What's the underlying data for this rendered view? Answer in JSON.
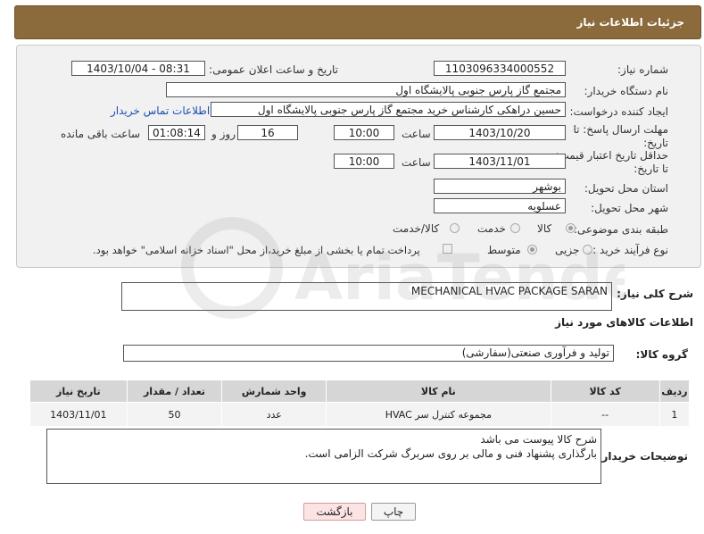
{
  "header": {
    "title": "جزئیات اطلاعات نیاز"
  },
  "form": {
    "need_number_label": "شماره نیاز:",
    "need_number": "1103096334000552",
    "announce_label": "تاریخ و ساعت اعلان عمومی:",
    "announce_value": "1403/10/04 - 08:31",
    "buyer_org_label": "نام دستگاه خریدار:",
    "buyer_org": "مجتمع گاز پارس جنوبی  پالایشگاه اول",
    "creator_label": "ایجاد کننده درخواست:",
    "creator": "حسین دراهکی کارشناس خرید مجتمع گاز پارس جنوبی  پالایشگاه اول",
    "contact_link": "اطلاعات تماس خریدار",
    "deadline_label": "مهلت ارسال پاسخ: تا تاریخ:",
    "deadline_date": "1403/10/20",
    "time_label": "ساعت",
    "deadline_time": "10:00",
    "days_value": "16",
    "days_label": "روز و",
    "remaining_value": "01:08:14",
    "remaining_label": "ساعت باقی مانده",
    "validity_label": "حداقل تاریخ اعتبار قیمت: تا تاریخ:",
    "validity_date": "1403/11/01",
    "validity_time": "10:00",
    "province_label": "استان محل تحویل:",
    "province": "بوشهر",
    "city_label": "شهر محل تحویل:",
    "city": "عسلویه",
    "category_label": "طبقه بندی موضوعی:",
    "category_options": [
      "کالا",
      "خدمت",
      "کالا/خدمت"
    ],
    "process_label": "نوع فرآیند خرید :",
    "process_options": [
      "جزیی",
      "متوسط"
    ],
    "payment_note": "پرداخت تمام یا بخشی از مبلغ خرید،از محل \"اسناد خزانه اسلامی\" خواهد بود."
  },
  "summary": {
    "label": "شرح کلی نیاز:",
    "value": "MECHANICAL HVAC PACKAGE SARAN"
  },
  "goods_info": {
    "title": "اطلاعات کالاهای مورد نیاز"
  },
  "goods_group": {
    "label": "گروه کالا:",
    "value": "تولید و فرآوری صنعتی(سفارشی)"
  },
  "table": {
    "headers": [
      "ردیف",
      "کد کالا",
      "نام کالا",
      "واحد شمارش",
      "تعداد / مقدار",
      "تاریخ نیاز"
    ],
    "rows": [
      [
        "1",
        "--",
        "مجموعه کنترل سر HVAC",
        "عدد",
        "50",
        "1403/11/01"
      ]
    ]
  },
  "buyer_notes": {
    "label": "توضیحات خریدار:",
    "line1": "شرح کالا پیوست می باشد",
    "line2": "بارگذاری پشنهاد فنی و مالی بر روی سربرگ شرکت الزامی است."
  },
  "buttons": {
    "print": "چاپ",
    "back": "بازگشت"
  },
  "watermark": {
    "text": "AriaTender.net"
  }
}
